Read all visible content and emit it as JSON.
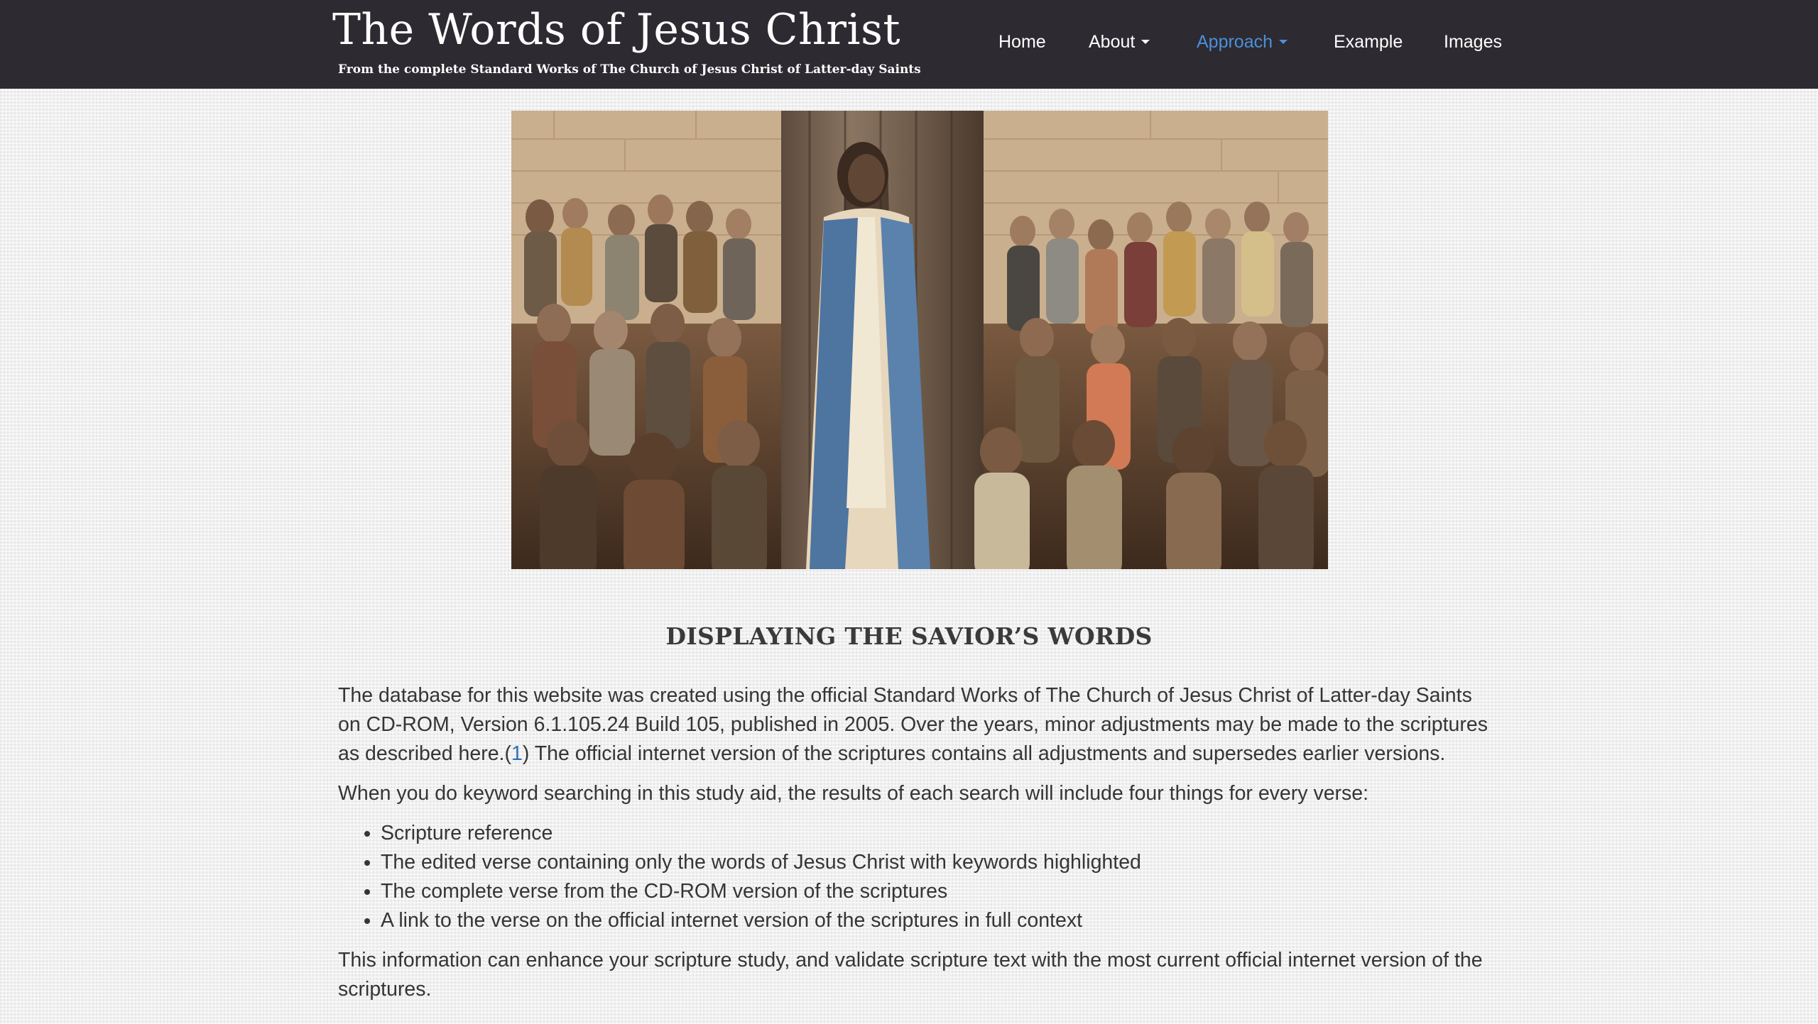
{
  "header": {
    "title": "The Words of Jesus Christ",
    "subtitle": "From the complete Standard Works of The Church of Jesus Christ of Latter-day Saints"
  },
  "nav": {
    "home": "Home",
    "about": "About",
    "approach": "Approach",
    "example": "Example",
    "images": "Images",
    "active_item": "Approach"
  },
  "main": {
    "heading": "DISPLAYING THE SAVIOR’S WORDS",
    "p1_before": "The database for this website was created using the official Standard Works of The Church of Jesus Christ of Latter-day Saints on CD-ROM, Version 6.1.105.24 Build 105, published in 2005. Over the years, minor adjustments may be made to the scriptures as described here.(",
    "p1_link": "1",
    "p1_after": ") The official internet version of the scriptures contains all adjustments and supersedes earlier versions.",
    "p2": "When you do keyword searching in this study aid, the results of each search will include four things for every verse:",
    "list": [
      "Scripture reference",
      "The edited verse containing only the words of Jesus Christ with keywords highlighted",
      "The complete verse from the CD-ROM version of the scriptures",
      "A link to the verse on the official internet version of the scriptures in full context"
    ],
    "p3": "This information can enhance your scripture study, and validate scripture text with the most current official internet version of the scriptures."
  },
  "colors": {
    "navbar_bg": "#2e2a31",
    "nav_active": "#4a90d9",
    "link": "#2f6fb5",
    "text": "#353535"
  }
}
